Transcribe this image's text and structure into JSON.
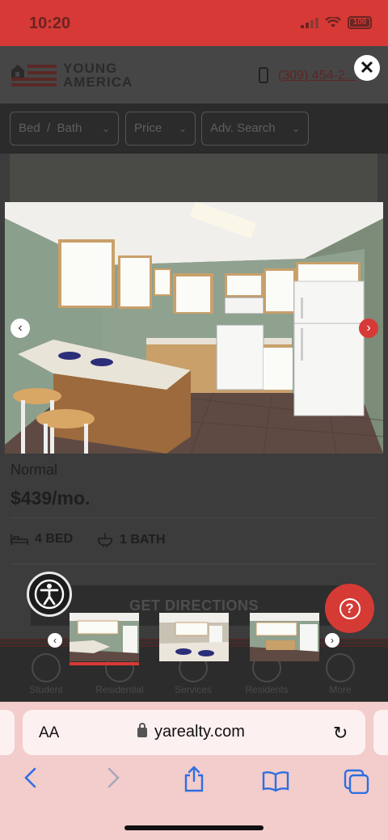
{
  "status": {
    "time": "10:20",
    "battery": "100"
  },
  "site": {
    "logo_line1": "YOUNG",
    "logo_line2": "AMERICA",
    "phone": "(309) 454-2...",
    "filters": [
      {
        "label": "Bed  /  Bath"
      },
      {
        "label": "Price"
      },
      {
        "label": "Adv. Search"
      }
    ]
  },
  "listing": {
    "name": "Normal",
    "price": "$439/mo.",
    "beds": "4 BED",
    "baths": "1 BATH",
    "directions_label": "GET DIRECTIONS"
  },
  "sitenav": [
    {
      "label": "Student"
    },
    {
      "label": "Residential"
    },
    {
      "label": "Services"
    },
    {
      "label": "Residents"
    },
    {
      "label": "More"
    }
  ],
  "safari": {
    "aa_label": "AA",
    "url": "yarealty.com"
  },
  "colors": {
    "accent": "#d73a36",
    "browser_icon": "#2d6fe0"
  }
}
